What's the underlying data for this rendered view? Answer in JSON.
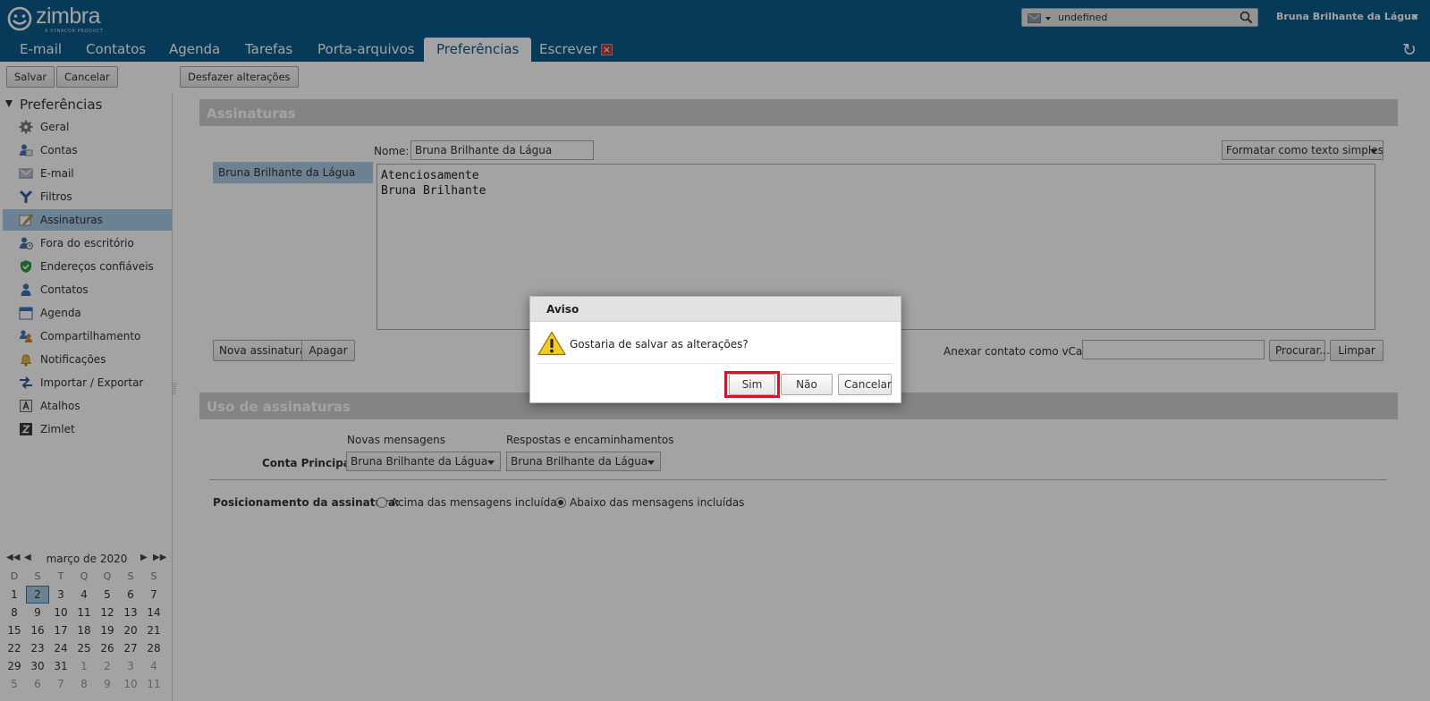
{
  "header": {
    "logo_text": "zimbra",
    "logo_subtext": "A SYNACOR PRODUCT",
    "search_value": "undefined",
    "search_type_icon": "mail-icon",
    "user_name": "Bruna Brilhante da Lágua"
  },
  "tabs": [
    {
      "label": "E-mail"
    },
    {
      "label": "Contatos"
    },
    {
      "label": "Agenda"
    },
    {
      "label": "Tarefas"
    },
    {
      "label": "Porta-arquivos"
    },
    {
      "label": "Preferências",
      "active": true
    },
    {
      "label": "Escrever",
      "closable": true
    }
  ],
  "toolbar": {
    "save_label": "Salvar",
    "cancel_label": "Cancelar",
    "undo_label": "Desfazer alterações"
  },
  "sidebar": {
    "root_label": "Preferências",
    "items": [
      {
        "label": "Geral",
        "icon": "gear-icon"
      },
      {
        "label": "Contas",
        "icon": "accounts-icon"
      },
      {
        "label": "E-mail",
        "icon": "mail-icon"
      },
      {
        "label": "Filtros",
        "icon": "filter-icon"
      },
      {
        "label": "Assinaturas",
        "icon": "signature-icon",
        "selected": true
      },
      {
        "label": "Fora do escritório",
        "icon": "out-of-office-icon"
      },
      {
        "label": "Endereços confiáveis",
        "icon": "shield-icon"
      },
      {
        "label": "Contatos",
        "icon": "contact-icon"
      },
      {
        "label": "Agenda",
        "icon": "calendar-icon"
      },
      {
        "label": "Compartilhamento",
        "icon": "sharing-icon"
      },
      {
        "label": "Notificações",
        "icon": "bell-icon"
      },
      {
        "label": "Importar / Exportar",
        "icon": "import-export-icon"
      },
      {
        "label": "Atalhos",
        "icon": "shortcut-icon"
      },
      {
        "label": "Zimlet",
        "icon": "zimlet-icon"
      }
    ]
  },
  "calendar": {
    "title": "março de 2020",
    "weekdays": [
      "D",
      "S",
      "T",
      "Q",
      "Q",
      "S",
      "S"
    ],
    "weeks": [
      [
        "1",
        "2",
        "3",
        "4",
        "5",
        "6",
        "7"
      ],
      [
        "8",
        "9",
        "10",
        "11",
        "12",
        "13",
        "14"
      ],
      [
        "15",
        "16",
        "17",
        "18",
        "19",
        "20",
        "21"
      ],
      [
        "22",
        "23",
        "24",
        "25",
        "26",
        "27",
        "28"
      ],
      [
        "29",
        "30",
        "31",
        "1",
        "2",
        "3",
        "4"
      ],
      [
        "5",
        "6",
        "7",
        "8",
        "9",
        "10",
        "11"
      ]
    ],
    "today": "2"
  },
  "signatures": {
    "section_title": "Assinaturas",
    "name_label": "Nome:",
    "name_value": "Bruna Brilhante da Lágua",
    "format_label": "Formatar como texto simples",
    "list_item": "Bruna Brilhante da Lágua",
    "body_lines": [
      "Atenciosamente",
      "Bruna Brilhante"
    ],
    "new_button": "Nova assinatura",
    "delete_button": "Apagar",
    "vcard_label": "Anexar contato como vCard:",
    "vcard_value": "",
    "browse_button": "Procurar...",
    "clear_button": "Limpar"
  },
  "usage": {
    "section_title": "Uso de assinaturas",
    "new_messages_label": "Novas mensagens",
    "replies_label": "Respostas e encaminhamentos",
    "account_label": "Conta Principal:",
    "new_messages_value": "Bruna Brilhante da Lágua",
    "replies_value": "Bruna Brilhante da Lágua",
    "position_label": "Posicionamento da assinatura:",
    "position_options": [
      "Acima das mensagens incluídas",
      "Abaixo das mensagens incluídas"
    ],
    "position_selected": "Abaixo das mensagens incluídas"
  },
  "dialog": {
    "title": "Aviso",
    "message": "Gostaria de salvar as alterações?",
    "yes_button": "Sim",
    "no_button": "Não",
    "cancel_button": "Cancelar"
  },
  "colors": {
    "header_bg": "#0b5a8a",
    "selection": "#a9cbe6",
    "highlight_box": "#e0101f"
  }
}
